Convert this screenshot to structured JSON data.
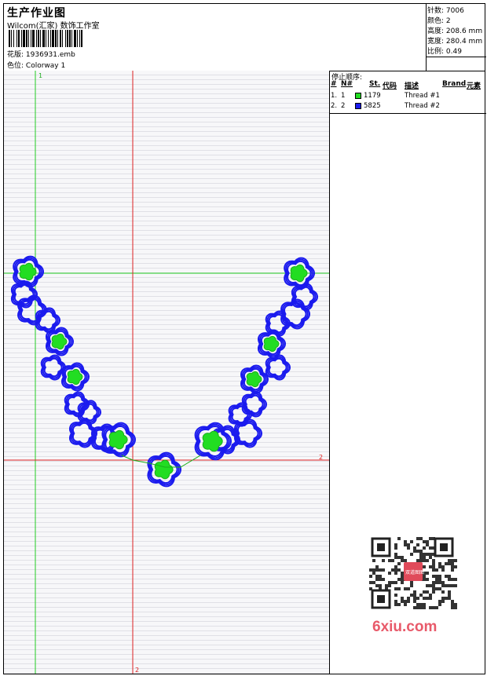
{
  "header": {
    "title": "生产作业图",
    "company": "Wilcom(汇家) 数饰工作室",
    "design_label": "花版:",
    "design_value": "1936931.emb",
    "colorway_label": "色位:",
    "colorway_value": "Colorway 1"
  },
  "stats": [
    {
      "label": "针数:",
      "value": "7006"
    },
    {
      "label": "颜色:",
      "value": "2"
    },
    {
      "label": "高度:",
      "value": "208.6 mm"
    },
    {
      "label": "宽度:",
      "value": "280.4 mm"
    },
    {
      "label": "比例:",
      "value": "0.49"
    }
  ],
  "stop_sequence": {
    "title": "停止顺序:",
    "headers": [
      "#",
      "N#",
      "St.",
      "代码",
      "描述",
      "Brand",
      "元素"
    ],
    "rows": [
      {
        "index": "1.",
        "n": "1",
        "color": "#22dd22",
        "code": "1179",
        "desc": "Thread #1"
      },
      {
        "index": "2.",
        "n": "2",
        "color": "#1a1aee",
        "code": "5825",
        "desc": "Thread #2"
      }
    ]
  },
  "guides": {
    "green_label": "1",
    "red_label_right": "2",
    "red_label_bottom": "2"
  },
  "watermark": {
    "brand": "6xiu.com",
    "badge": "双道图图"
  },
  "colors": {
    "outline": "#1a1aee",
    "fill": "#22dd22",
    "guide_green": "#22cc22",
    "guide_red": "#dd2222"
  }
}
